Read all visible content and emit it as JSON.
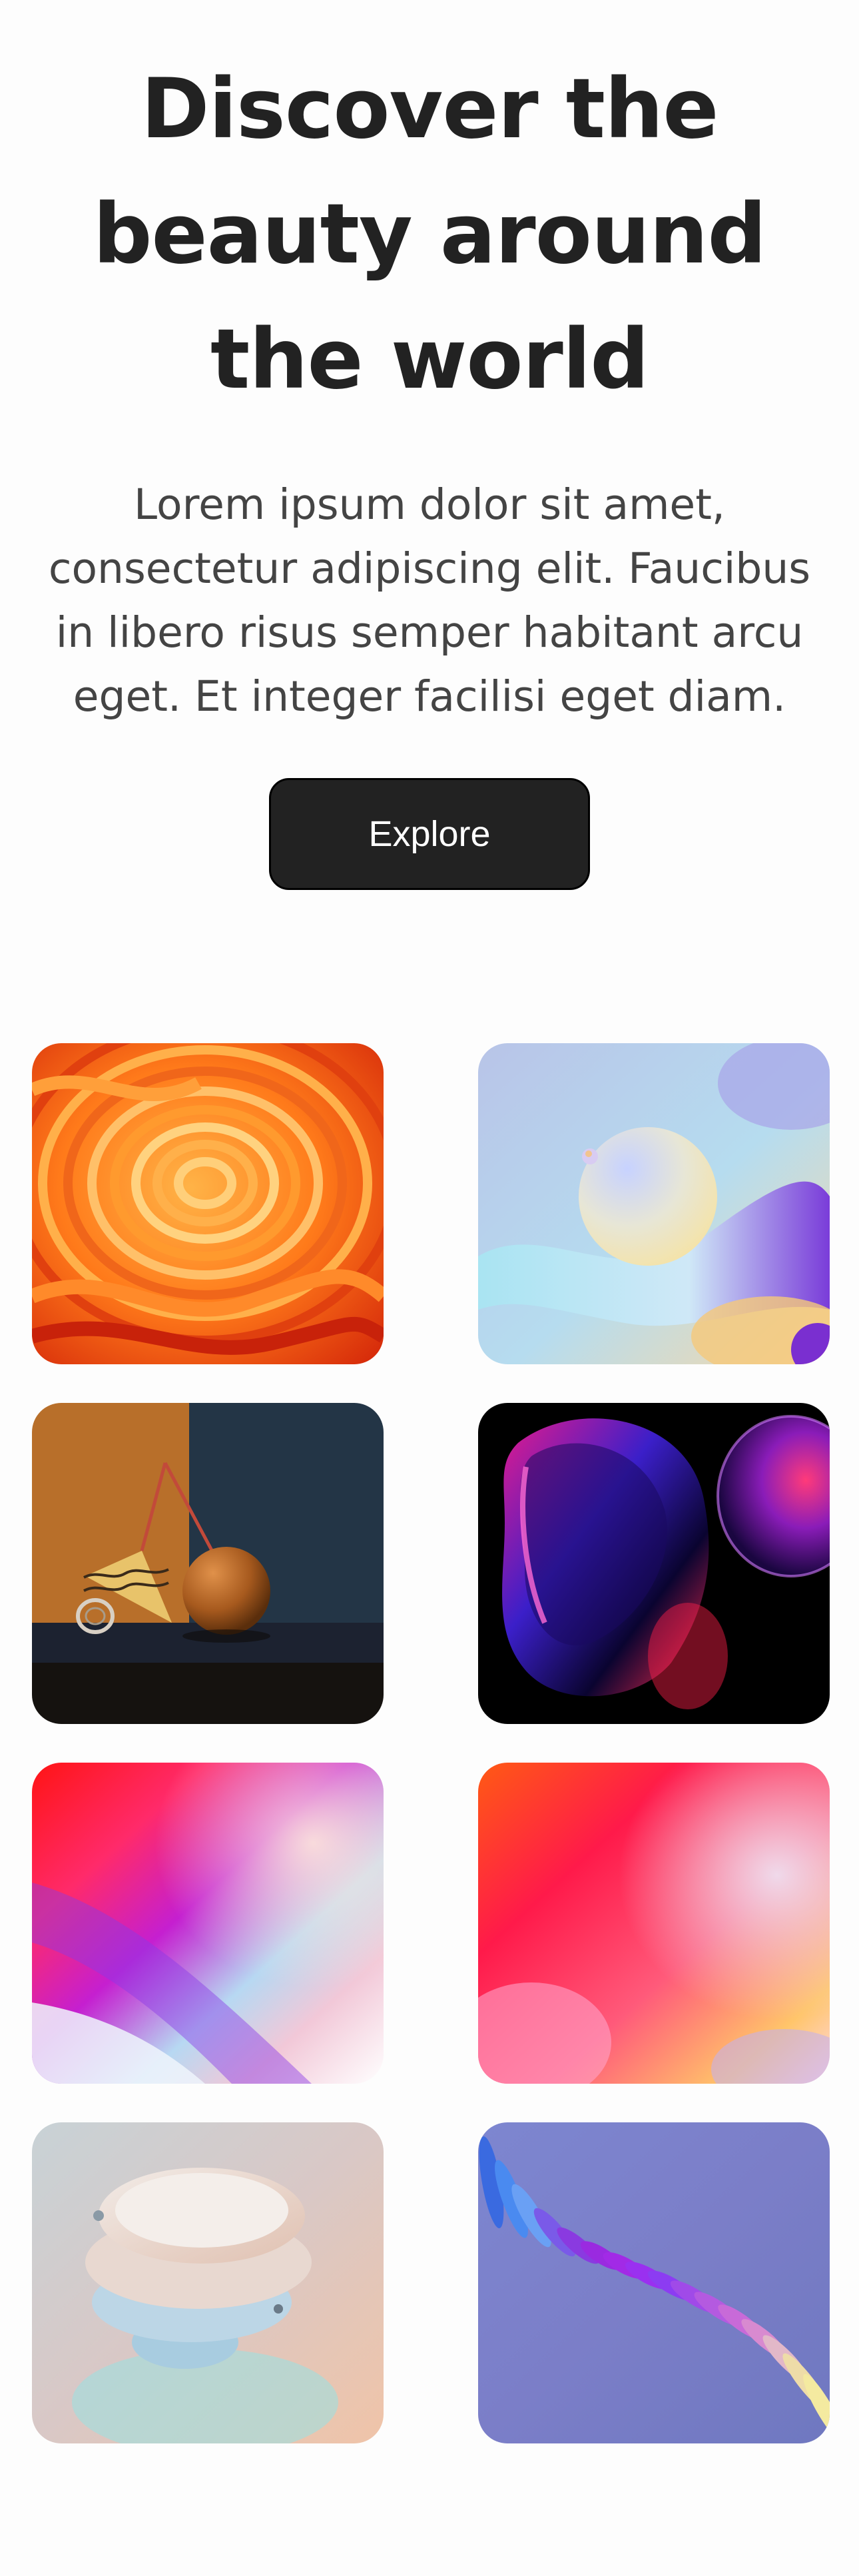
{
  "hero": {
    "title": "Discover the beauty around the world",
    "description": "Lorem ipsum dolor sit amet, consectetur adipiscing elit. Faucibus in libero risus semper habitant arcu eget. Et integer facilisi eget diam.",
    "cta_label": "Explore"
  },
  "gallery": {
    "images": [
      {
        "name": "orange-swirl-art"
      },
      {
        "name": "pastel-sphere-art"
      },
      {
        "name": "still-life-room-art"
      },
      {
        "name": "neon-blob-art"
      },
      {
        "name": "red-purple-gradient-art"
      },
      {
        "name": "orange-pink-gradient-art"
      },
      {
        "name": "pastel-disc-sculpture-art"
      },
      {
        "name": "purple-wave-ribbon-art"
      }
    ]
  },
  "colors": {
    "text": "#222222",
    "muted_text": "#444444",
    "button_bg": "#222222",
    "button_text": "#ffffff",
    "background": "#fdfdfd"
  }
}
